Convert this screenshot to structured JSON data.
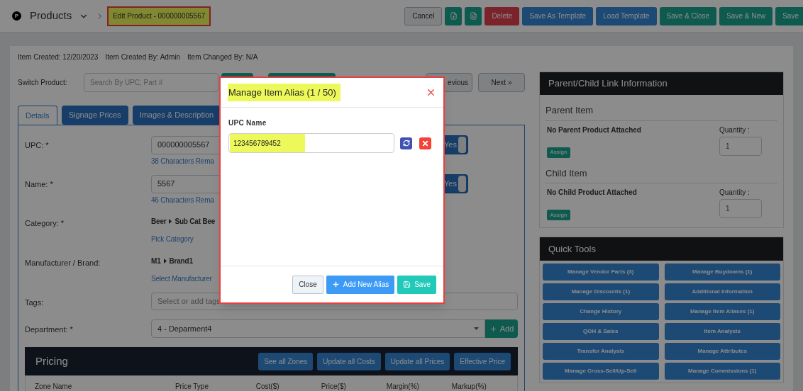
{
  "header": {
    "logo_letter": "P",
    "section": "Products",
    "breadcrumb": "Edit Product - 000000005567",
    "actions": [
      {
        "kind": "default",
        "label": "Cancel"
      },
      {
        "kind": "icon"
      },
      {
        "kind": "icon"
      },
      {
        "kind": "danger",
        "label": "Delete"
      },
      {
        "kind": "primary",
        "label": "Save As Template"
      },
      {
        "kind": "primary",
        "label": "Load Template"
      },
      {
        "kind": "success",
        "label": "Save & Close"
      },
      {
        "kind": "success",
        "label": "Save & New"
      },
      {
        "kind": "success",
        "label": "Save"
      }
    ]
  },
  "meta": [
    "Item Created: 12/20/2023",
    "Item Created By: Admin",
    "Item Changed By: N/A"
  ],
  "switch_product": {
    "label": "Switch Product:",
    "placeholder": "Search By UPC, Part #",
    "previous": "evious",
    "next": "Next »"
  },
  "tabs": [
    {
      "label": "Details",
      "selected": true
    },
    {
      "label": "Signage Prices",
      "selected": false
    },
    {
      "label": "Images & Description",
      "selected": false
    }
  ],
  "fields": [
    {
      "kind": "input",
      "label": "UPC: *",
      "value": "000000005567",
      "hint": "38 Characters Rema",
      "toggle": "Yes",
      "on": true
    },
    {
      "kind": "input",
      "label": "Name: *",
      "value": "5567",
      "hint": "46 Characters Rema",
      "toggle": "Yes",
      "on": true
    },
    {
      "kind": "path",
      "label": "Category: *",
      "parts": [
        "Beer",
        "Sub Cat Bee"
      ],
      "link": "Pick Category"
    },
    {
      "kind": "path",
      "label": "Manufacturer / Brand:",
      "parts": [
        "M1",
        "Brand1"
      ],
      "link": "Select Manufacturer"
    },
    {
      "kind": "tags",
      "label": "Tags:",
      "placeholder": "Select or add tags"
    },
    {
      "kind": "select",
      "label": "Department: *",
      "value": "4 - Deparment4",
      "button": "Add"
    }
  ],
  "pricing": {
    "title": "Pricing",
    "buttons": [
      "See all Zones",
      "Update all Costs",
      "Update all Prices",
      "Effective Price"
    ],
    "columns": [
      "Zone Name",
      "Price Type",
      "Cost($)",
      "Price($)",
      "Margin(%)",
      "Markup(%)"
    ]
  },
  "parent_child": {
    "title": "Parent/Child Link Information",
    "sections": [
      {
        "title": "Parent Item",
        "empty": "No Parent Product Attached",
        "assign": "Assign",
        "quantity_label": "Quantity :",
        "quantity": "1"
      },
      {
        "title": "Child Item",
        "empty": "No Child Product Attached",
        "assign": "Assign",
        "quantity_label": "Quantity :",
        "quantity": "1"
      }
    ]
  },
  "quick_tools": {
    "title": "Quick Tools",
    "items": [
      "Manage Vendor Parts (3)",
      "Manage Buydowns (1)",
      "Manage Discounts (1)",
      "Additional Information",
      "Change History",
      "Manage Item Aliases (1)",
      "QOH & Sales",
      "Item Analysis",
      "Transfer Analysis",
      "Manage Attributes",
      "Manage Cross-Sell/Up-Sell",
      "Manage Commissions (1)"
    ]
  },
  "modal": {
    "title": "Manage Item Alias (1 / 50)",
    "field_label": "UPC Name",
    "value": "123456789452",
    "buttons": [
      {
        "kind": "default",
        "label": "Close"
      },
      {
        "kind": "add",
        "label": "Add New Alias"
      },
      {
        "kind": "save",
        "label": "Save"
      }
    ]
  }
}
